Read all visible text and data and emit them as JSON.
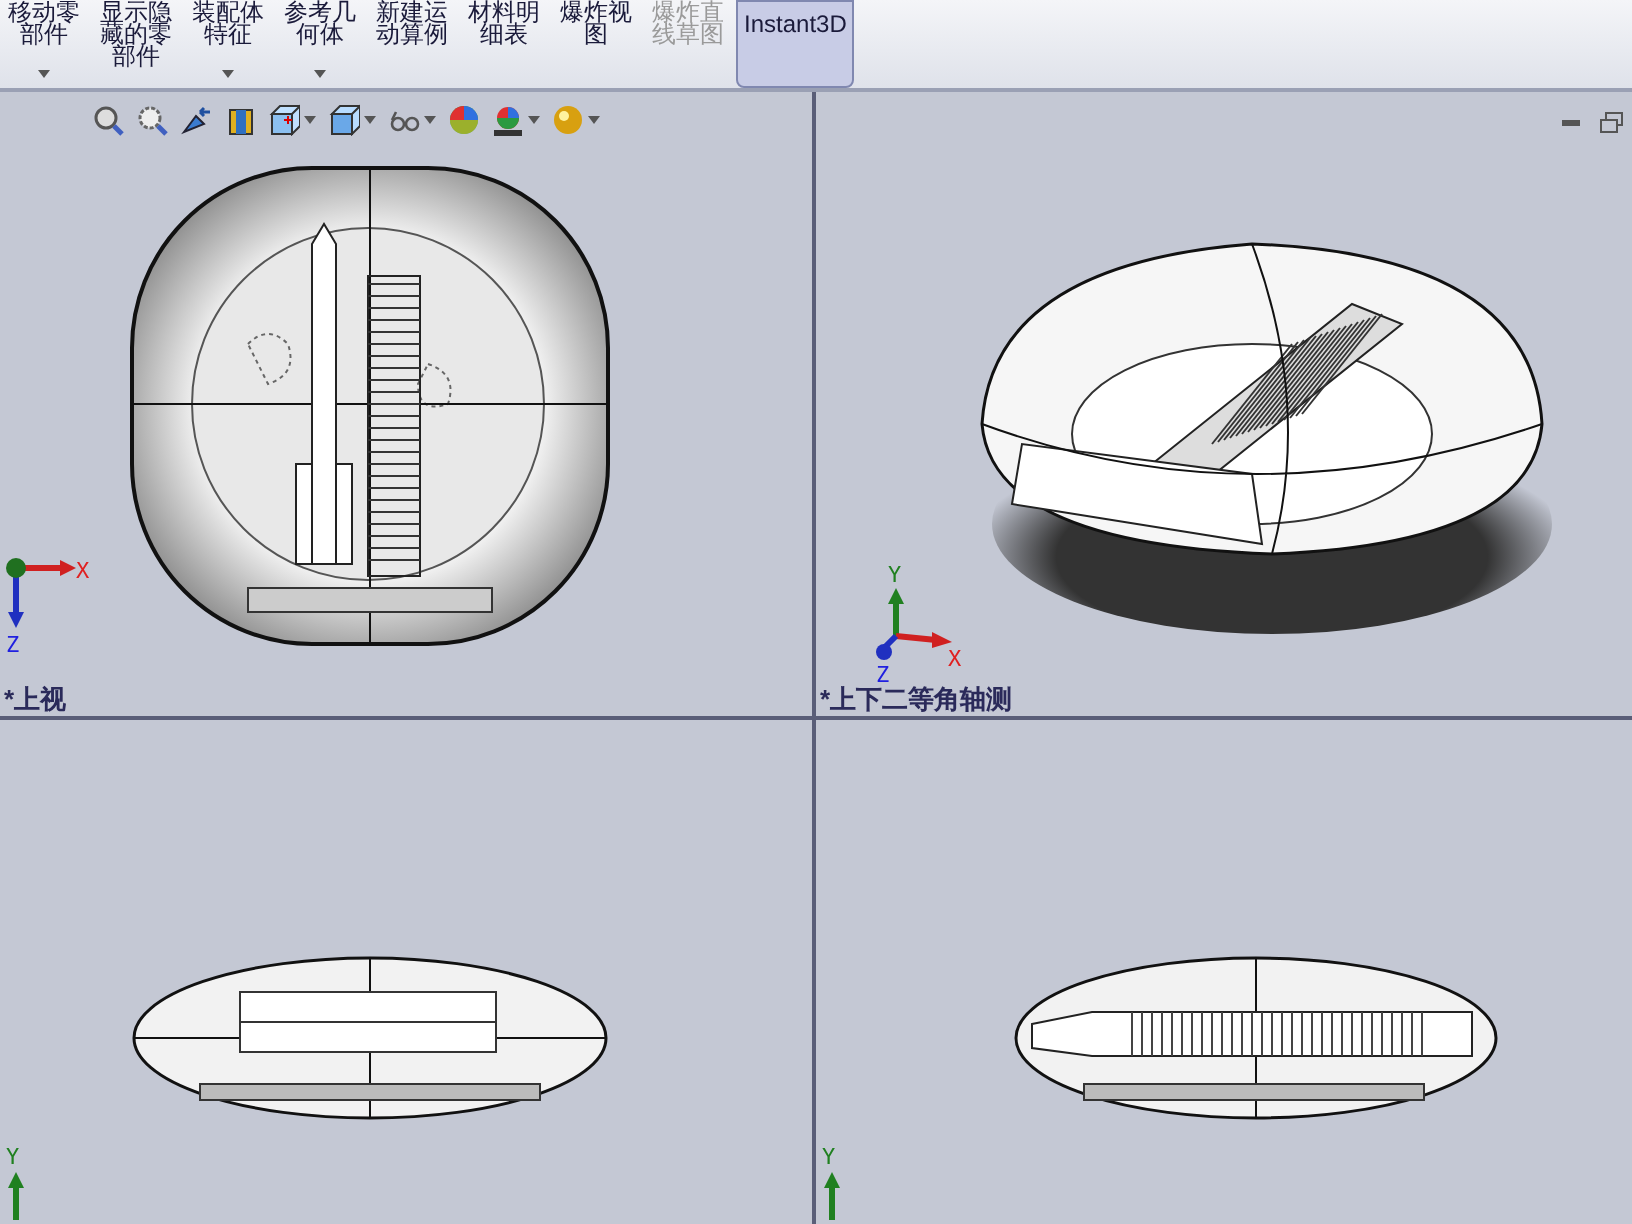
{
  "toolbar": {
    "buttons": [
      {
        "label": "移动零部件",
        "dropdown": true,
        "disabled": false,
        "selected": false
      },
      {
        "label": "显示隐藏的零部件",
        "dropdown": false,
        "disabled": false,
        "selected": false
      },
      {
        "label": "装配体特征",
        "dropdown": true,
        "disabled": false,
        "selected": false
      },
      {
        "label": "参考几何体",
        "dropdown": true,
        "disabled": false,
        "selected": false
      },
      {
        "label": "新建运动算例",
        "dropdown": false,
        "disabled": false,
        "selected": false
      },
      {
        "label": "材料明细表",
        "dropdown": false,
        "disabled": false,
        "selected": false
      },
      {
        "label": "爆炸视图",
        "dropdown": false,
        "disabled": false,
        "selected": false
      },
      {
        "label": "爆炸直线草图",
        "dropdown": false,
        "disabled": true,
        "selected": false
      },
      {
        "label": "Instant3D",
        "dropdown": false,
        "disabled": false,
        "selected": true
      }
    ]
  },
  "heads_up_toolbar": [
    {
      "kind": "zoom-fit",
      "dropdown": false
    },
    {
      "kind": "zoom-area",
      "dropdown": false
    },
    {
      "kind": "previous-view",
      "dropdown": false
    },
    {
      "kind": "section",
      "dropdown": false
    },
    {
      "kind": "orientation",
      "dropdown": true
    },
    {
      "kind": "display-style",
      "dropdown": true
    },
    {
      "kind": "hide-show",
      "dropdown": true
    },
    {
      "kind": "appearance",
      "dropdown": false
    },
    {
      "kind": "scene",
      "dropdown": true
    },
    {
      "kind": "view-settings",
      "dropdown": true
    }
  ],
  "viewports": [
    {
      "kind": "top",
      "view_label": "*上视",
      "axes": [
        {
          "kind": "x",
          "label": "X"
        },
        {
          "kind": "z",
          "label": "Z"
        }
      ]
    },
    {
      "kind": "iso",
      "view_label": "*上下二等角轴测",
      "window_buttons": [
        {
          "kind": "minimize"
        },
        {
          "kind": "restore"
        }
      ],
      "axes": [
        {
          "kind": "y",
          "label": "Y"
        },
        {
          "kind": "x",
          "label": "X"
        },
        {
          "kind": "z",
          "label": "Z"
        }
      ]
    },
    {
      "kind": "front",
      "axes": [
        {
          "kind": "y",
          "label": "Y"
        }
      ]
    },
    {
      "kind": "right",
      "axes": [
        {
          "kind": "y",
          "label": "Y"
        }
      ]
    }
  ]
}
